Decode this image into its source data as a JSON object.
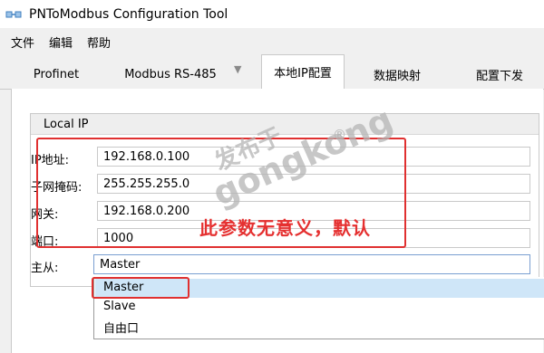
{
  "window": {
    "title": "PNToModbus Configuration Tool"
  },
  "menu": {
    "items": [
      "文件",
      "编辑",
      "帮助"
    ]
  },
  "tabs": [
    {
      "label": "Profinet"
    },
    {
      "label": "Modbus RS-485"
    },
    {
      "label": "本地IP配置",
      "active": true
    },
    {
      "label": "数据映射"
    },
    {
      "label": "配置下发"
    }
  ],
  "group": {
    "title": "Local IP"
  },
  "fields": {
    "ip": {
      "label": "IP地址:",
      "value": "192.168.0.100"
    },
    "mask": {
      "label": "子网掩码:",
      "value": "255.255.255.0"
    },
    "gateway": {
      "label": "网关:",
      "value": "192.168.0.200"
    },
    "port": {
      "label": "端口:",
      "value": "1000"
    },
    "role": {
      "label": "主从:",
      "value": "Master"
    }
  },
  "dropdown": {
    "options": [
      "Master",
      "Slave",
      "自由口"
    ],
    "selected": "Master"
  },
  "annotation": {
    "text": "此参数无意义，默认"
  },
  "watermark": {
    "line1": "发布于",
    "line2": "gongkong",
    "mark": "®"
  },
  "colors": {
    "annotation_red": "#e03030",
    "selected_option_bg": "#cfe6f8",
    "accent_blue": "#1a5fb4"
  }
}
